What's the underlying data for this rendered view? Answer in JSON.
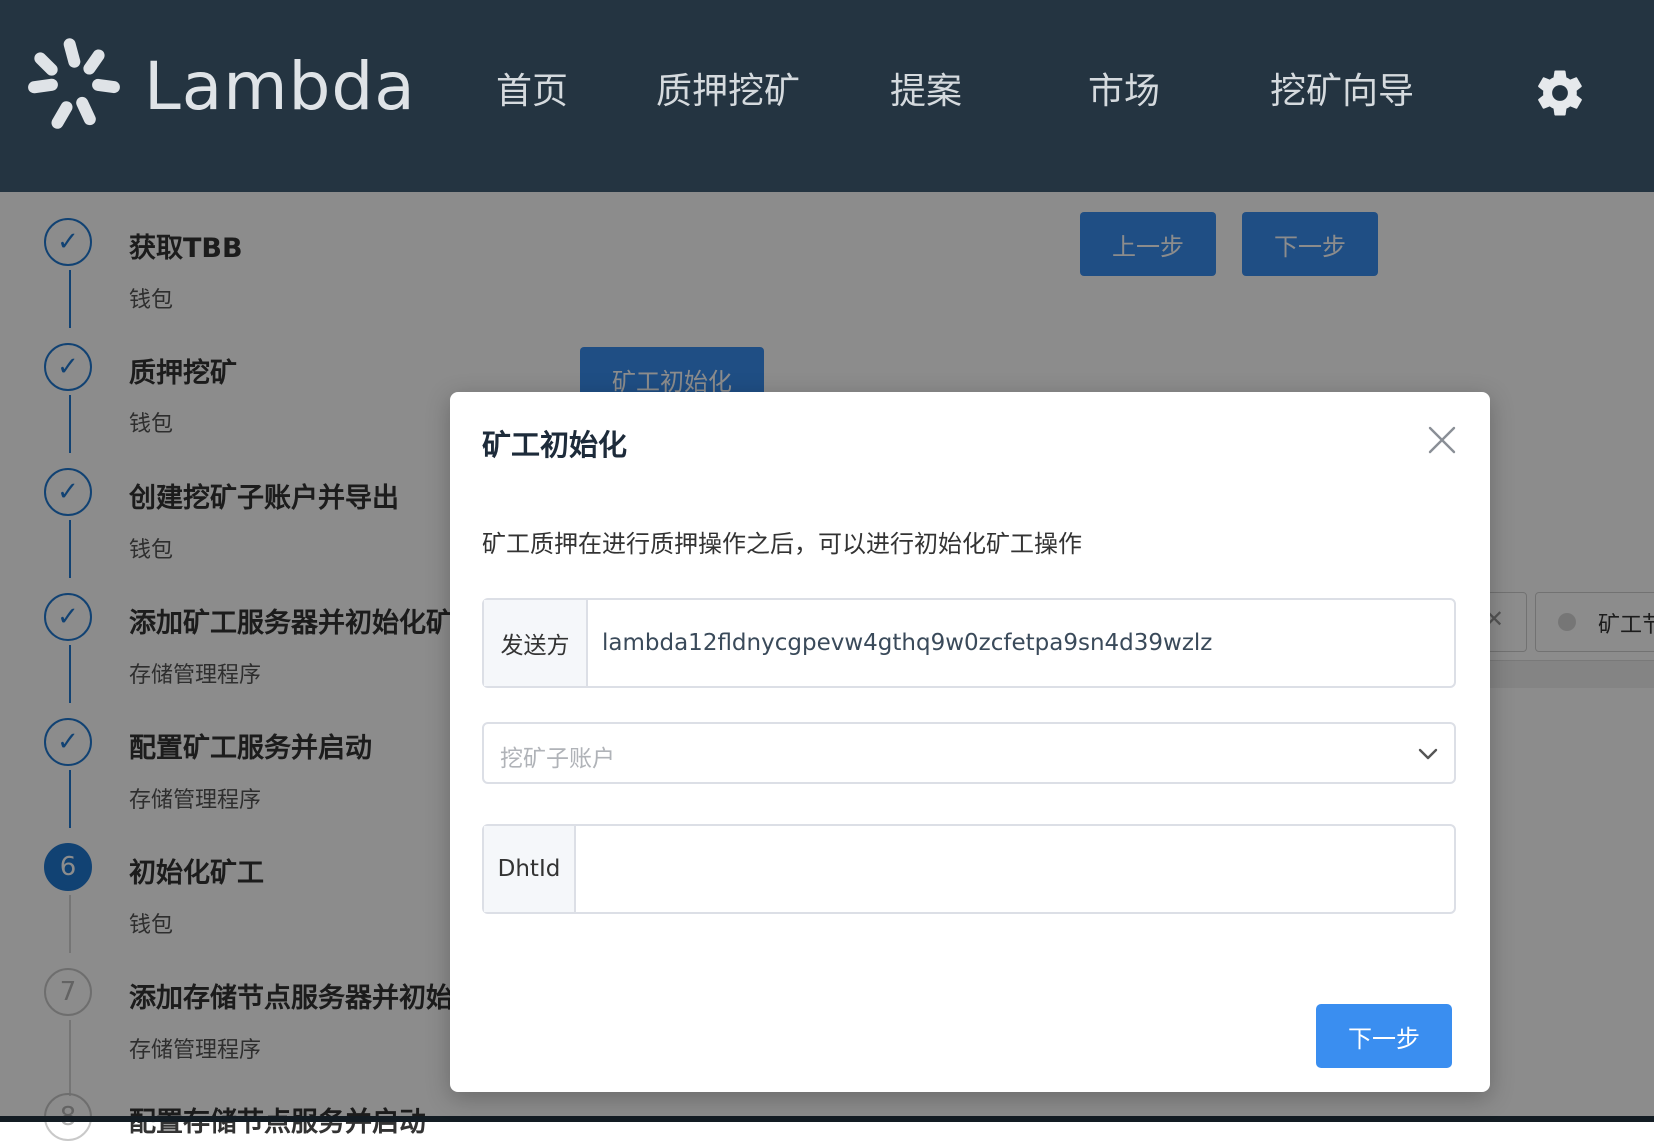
{
  "header": {
    "brand": "Lambda",
    "nav": [
      {
        "label": "首页"
      },
      {
        "label": "质押挖矿"
      },
      {
        "label": "提案"
      },
      {
        "label": "市场"
      },
      {
        "label": "挖矿向导"
      }
    ]
  },
  "steps": [
    {
      "title": "获取TBB",
      "desc": "钱包",
      "status": "done"
    },
    {
      "title": "质押挖矿",
      "desc": "钱包",
      "status": "done"
    },
    {
      "title": "创建挖矿子账户并导出",
      "desc": "钱包",
      "status": "done"
    },
    {
      "title": "添加矿工服务器并初始化矿",
      "desc": "存储管理程序",
      "status": "done"
    },
    {
      "title": "配置矿工服务并启动",
      "desc": "存储管理程序",
      "status": "done"
    },
    {
      "number": "6",
      "title": "初始化矿工",
      "desc": "钱包",
      "status": "active"
    },
    {
      "number": "7",
      "title": "添加存储节点服务器并初始",
      "desc": "存储管理程序",
      "status": "pending"
    },
    {
      "number": "8",
      "title": "配置存储节点服务并启动",
      "desc": "",
      "status": "pending"
    }
  ],
  "background": {
    "prev_button": "上一步",
    "next_button": "下一步",
    "init_button": "矿工初始化",
    "tab_label": "矿工节"
  },
  "modal": {
    "title": "矿工初始化",
    "description": "矿工质押在进行质押操作之后，可以进行初始化矿工操作",
    "sender_label": "发送方",
    "sender_value": "lambda12fldnycgpevw4gthq9w0zcfetpa9sn4d39wzlz",
    "subaccount_placeholder": "挖矿子账户",
    "dhtid_label": "DhtId",
    "dhtid_value": "",
    "next_button": "下一步"
  },
  "colors": {
    "header_bg": "#243441",
    "primary": "#3a8ef0",
    "step_blue": "#1f78d1"
  }
}
